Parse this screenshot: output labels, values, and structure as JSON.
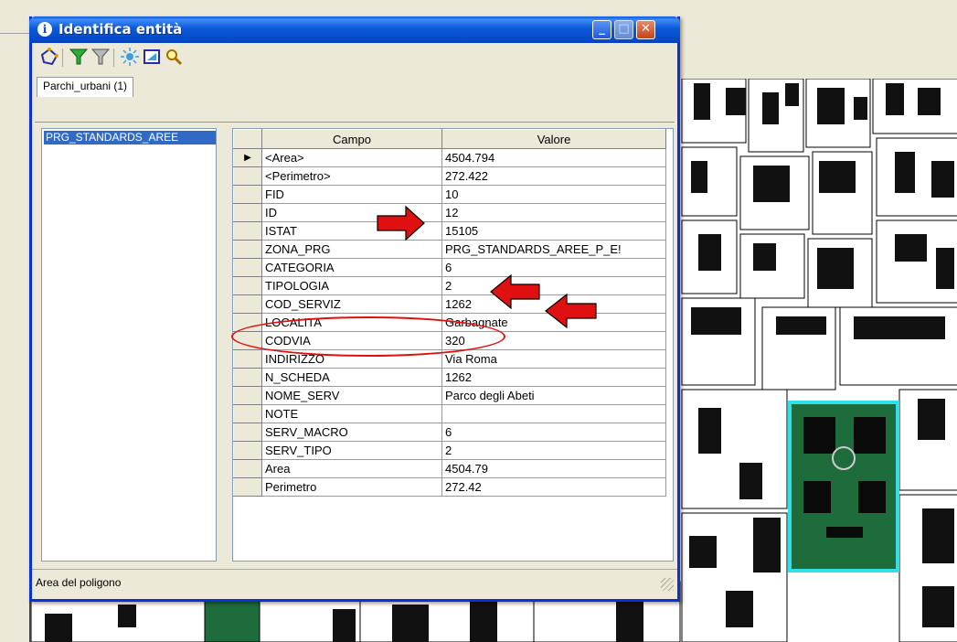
{
  "window": {
    "title": "Identifica entità",
    "title_icon": "info-icon"
  },
  "toolbar_icons": [
    "identify-polygon-icon",
    "filter-green-icon",
    "filter-gray-icon",
    "highlight-feature-icon",
    "zoom-to-feature-icon",
    "pan-to-feature-icon"
  ],
  "tab": {
    "label": "Parchi_urbani (1)"
  },
  "feature_list": {
    "selected": "PRG_STANDARDS_AREE"
  },
  "grid": {
    "headers": {
      "campo": "Campo",
      "valore": "Valore"
    },
    "rows": [
      {
        "campo": "<Area>",
        "valore": "4504.794",
        "current": true
      },
      {
        "campo": "<Perimetro>",
        "valore": "272.422"
      },
      {
        "campo": "FID",
        "valore": "10"
      },
      {
        "campo": "ID",
        "valore": "12"
      },
      {
        "campo": "ISTAT",
        "valore": "15105"
      },
      {
        "campo": "ZONA_PRG",
        "valore": "PRG_STANDARDS_AREE_P_E!"
      },
      {
        "campo": "CATEGORIA",
        "valore": "6"
      },
      {
        "campo": "TIPOLOGIA",
        "valore": "2"
      },
      {
        "campo": "COD_SERVIZ",
        "valore": "1262"
      },
      {
        "campo": "LOCALITA",
        "valore": "Garbagnate"
      },
      {
        "campo": "CODVIA",
        "valore": "320"
      },
      {
        "campo": "INDIRIZZO",
        "valore": "Via Roma"
      },
      {
        "campo": "N_SCHEDA",
        "valore": "1262"
      },
      {
        "campo": "NOME_SERV",
        "valore": "Parco degli Abeti"
      },
      {
        "campo": "NOTE",
        "valore": ""
      },
      {
        "campo": "SERV_MACRO",
        "valore": "6"
      },
      {
        "campo": "SERV_TIPO",
        "valore": "2"
      },
      {
        "campo": "Area",
        "valore": "4504.79"
      },
      {
        "campo": "Perimetro",
        "valore": "272.42"
      }
    ]
  },
  "status": {
    "text": "Area del poligono"
  },
  "colors": {
    "title_bar": "#0a59d9",
    "selection": "#316ac5",
    "annotation_red": "#e01010",
    "park_green": "#1e6b3c",
    "park_outline": "#30e0e8"
  }
}
